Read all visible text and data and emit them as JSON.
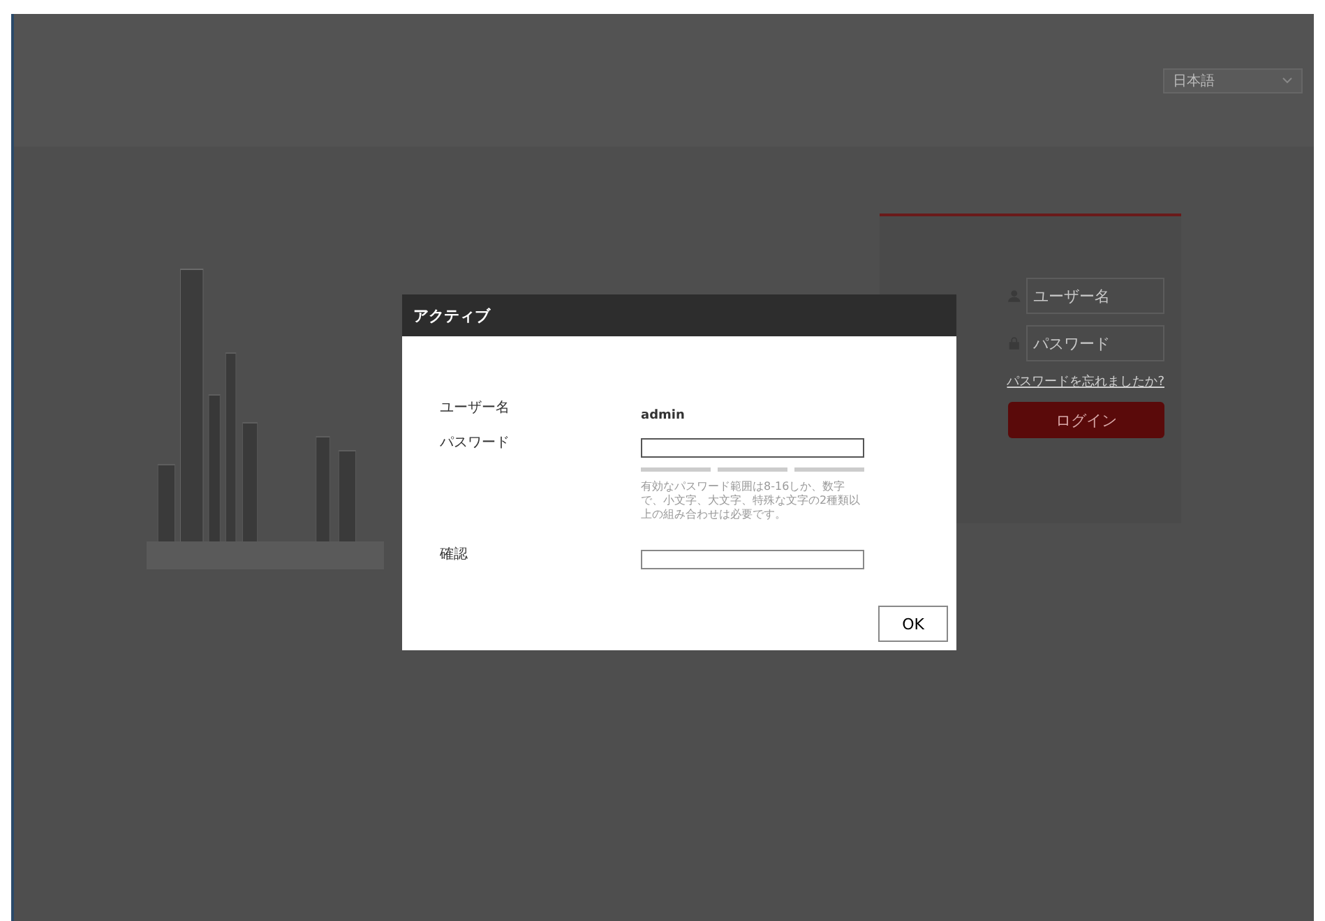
{
  "language_select": {
    "value": "日本語"
  },
  "login": {
    "username": {
      "placeholder": "ユーザー名"
    },
    "password": {
      "placeholder": "パスワード"
    },
    "forgot_link": "パスワードを忘れましたか?",
    "login_button": "ログイン"
  },
  "dialog": {
    "title": "アクティブ",
    "fields": [
      {
        "kind": "text",
        "label": "ユーザー名",
        "value": "admin"
      },
      {
        "kind": "password",
        "label": "パスワード",
        "hint": "有効なパスワード範囲は8-16しか、数字で、小文字、大文字、特殊な文字の2種類以上の組み合わせは必要です。"
      },
      {
        "kind": "confirm",
        "label": "確認"
      }
    ],
    "ok_button": "OK"
  }
}
